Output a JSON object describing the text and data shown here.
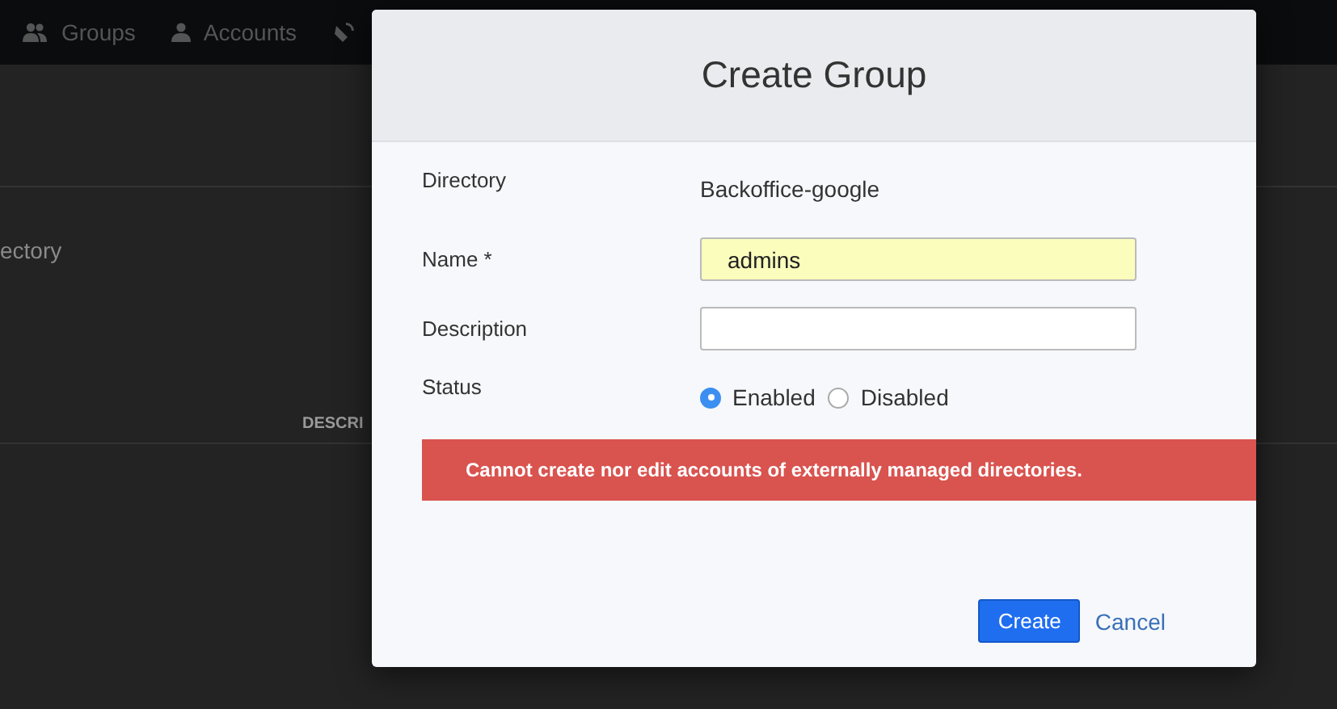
{
  "nav": {
    "items": [
      {
        "label": "Groups"
      },
      {
        "label": "Accounts"
      }
    ]
  },
  "background_page": {
    "text_1": "ectory",
    "table_header": "DESCRI"
  },
  "modal": {
    "title": "Create Group",
    "fields": [
      {
        "kind": "text",
        "label": "Directory",
        "value": "Backoffice-google"
      },
      {
        "kind": "input",
        "label": "Name *",
        "value": "admins",
        "autofilled": true
      },
      {
        "kind": "input",
        "label": "Description",
        "autofilled": false
      },
      {
        "kind": "radio",
        "label": "Status",
        "options": [
          {
            "label": "Enabled",
            "selected": true
          },
          {
            "label": "Disabled",
            "selected": false
          }
        ]
      }
    ],
    "alert": "Cannot create nor edit accounts of externally managed directories.",
    "buttons": [
      {
        "kind": "primary",
        "label": "Create"
      },
      {
        "kind": "link",
        "label": "Cancel"
      }
    ]
  }
}
